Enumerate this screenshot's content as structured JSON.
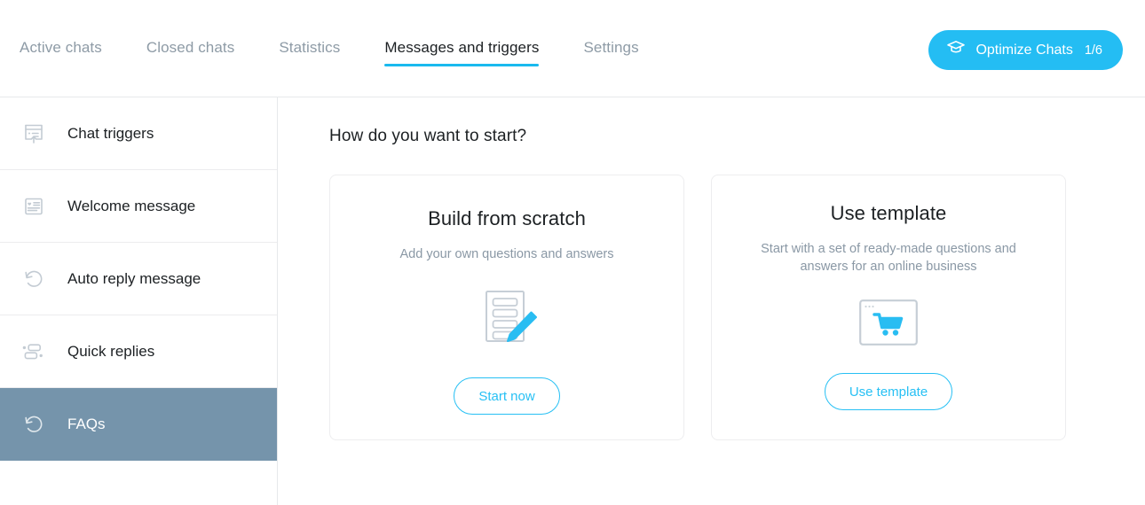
{
  "nav": {
    "tabs": [
      {
        "label": "Active chats",
        "active": false
      },
      {
        "label": "Closed chats",
        "active": false
      },
      {
        "label": "Statistics",
        "active": false
      },
      {
        "label": "Messages and triggers",
        "active": true
      },
      {
        "label": "Settings",
        "active": false
      }
    ],
    "optimize_button": {
      "label": "Optimize Chats",
      "count": "1/6",
      "icon": "graduation-cap-icon",
      "color": "#24bdf3"
    },
    "active_underline_color": "#19b9ee"
  },
  "sidebar": {
    "selected_bg": "#7594ab",
    "items": [
      {
        "label": "Chat triggers",
        "icon": "chat-trigger-icon",
        "selected": false
      },
      {
        "label": "Welcome message",
        "icon": "welcome-message-icon",
        "selected": false
      },
      {
        "label": "Auto reply message",
        "icon": "auto-reply-icon",
        "selected": false
      },
      {
        "label": "Quick replies",
        "icon": "quick-replies-icon",
        "selected": false
      },
      {
        "label": "FAQs",
        "icon": "faqs-icon",
        "selected": true
      }
    ]
  },
  "main": {
    "heading": "How do you want to start?",
    "cards": [
      {
        "title": "Build from scratch",
        "subtitle": "Add your own questions and answers",
        "icon": "document-pencil-icon",
        "button": "Start now"
      },
      {
        "title": "Use template",
        "subtitle": "Start with a set of ready-made questions and answers for an online business",
        "icon": "browser-cart-icon",
        "button": "Use template"
      }
    ],
    "accent_color": "#27c0f4"
  }
}
